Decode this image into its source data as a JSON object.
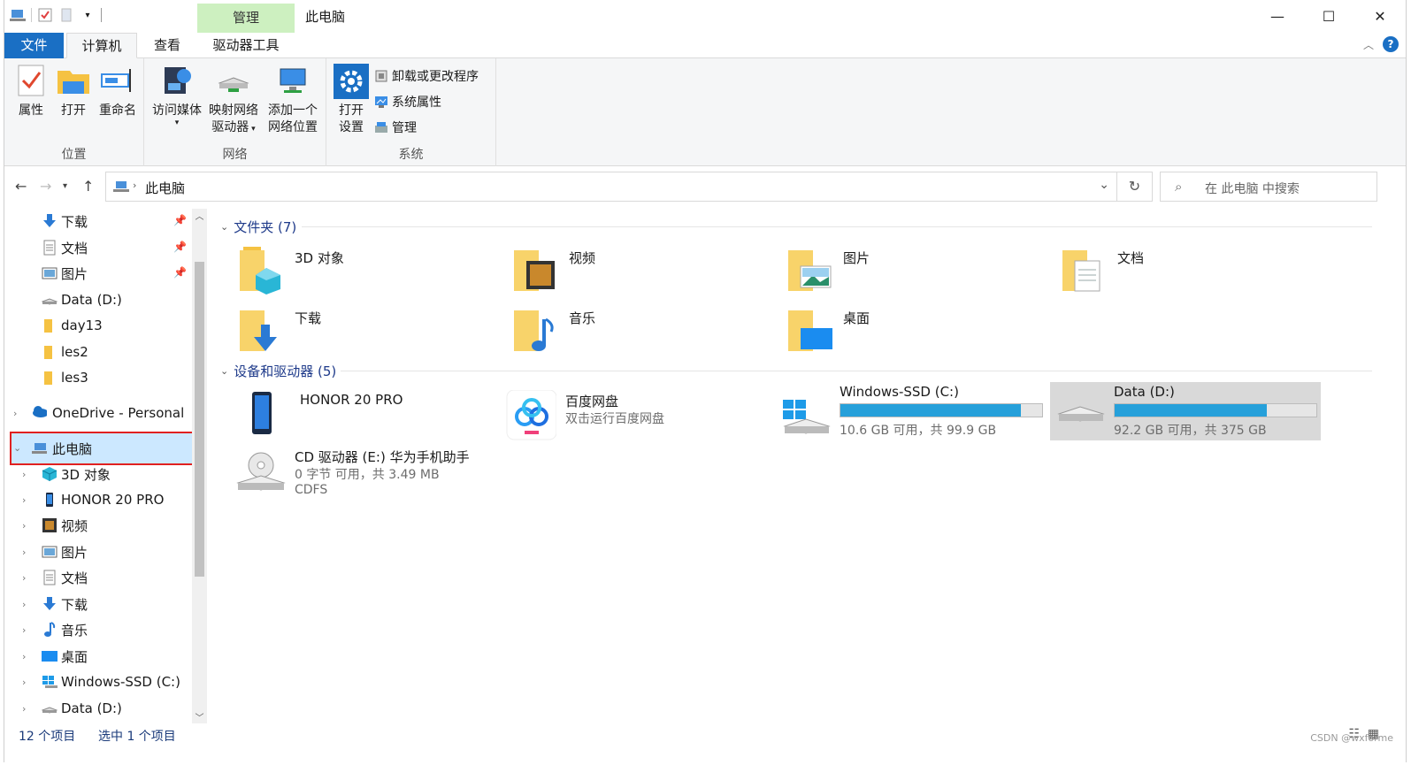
{
  "window": {
    "title": "此电脑",
    "context_tab": "管理",
    "controls": {
      "minimize": "—",
      "maximize": "☐",
      "close": "✕"
    }
  },
  "tabs": [
    {
      "label": "文件"
    },
    {
      "label": "计算机"
    },
    {
      "label": "查看"
    },
    {
      "label": "驱动器工具"
    }
  ],
  "ribbon": {
    "groups": [
      {
        "label": "位置",
        "buttons": [
          "属性",
          "打开",
          "重命名"
        ]
      },
      {
        "label": "网络",
        "buttons": [
          "访问媒体",
          "映射网络\n驱动器",
          "添加一个\n网络位置"
        ]
      },
      {
        "label": "系统",
        "big": "打开\n设置",
        "small": [
          "卸载或更改程序",
          "系统属性",
          "管理"
        ]
      }
    ],
    "btn_props": "属性",
    "btn_open": "打开",
    "btn_rename": "重命名",
    "btn_media": "访问媒体",
    "btn_map1": "映射网络",
    "btn_map2": "驱动器",
    "btn_add1": "添加一个",
    "btn_add2": "网络位置",
    "btn_settings1": "打开",
    "btn_settings2": "设置",
    "small_uninstall": "卸载或更改程序",
    "small_sysprops": "系统属性",
    "small_manage": "管理",
    "g_location": "位置",
    "g_network": "网络",
    "g_system": "系统"
  },
  "address": {
    "breadcrumb": "此电脑",
    "search_placeholder": "在 此电脑 中搜索"
  },
  "nav": {
    "quick": [
      {
        "label": "下载",
        "pinned": true
      },
      {
        "label": "文档",
        "pinned": true
      },
      {
        "label": "图片",
        "pinned": true
      },
      {
        "label": "Data (D:)"
      },
      {
        "label": "day13"
      },
      {
        "label": "les2"
      },
      {
        "label": "les3"
      }
    ],
    "onedrive": "OneDrive - Personal",
    "this_pc": "此电脑",
    "pc_children": [
      {
        "label": "3D 对象"
      },
      {
        "label": "HONOR 20 PRO"
      },
      {
        "label": "视频"
      },
      {
        "label": "图片"
      },
      {
        "label": "文档"
      },
      {
        "label": "下载"
      },
      {
        "label": "音乐"
      },
      {
        "label": "桌面"
      },
      {
        "label": "Windows-SSD (C:)"
      },
      {
        "label": "Data (D:)"
      }
    ]
  },
  "content": {
    "folders_header": "文件夹 (7)",
    "folders": [
      {
        "label": "3D 对象"
      },
      {
        "label": "视频"
      },
      {
        "label": "图片"
      },
      {
        "label": "文档"
      },
      {
        "label": "下载"
      },
      {
        "label": "音乐"
      },
      {
        "label": "桌面"
      }
    ],
    "devices_header": "设备和驱动器 (5)",
    "devices": [
      {
        "label": "HONOR 20 PRO"
      },
      {
        "label": "百度网盘",
        "sub": "双击运行百度网盘"
      },
      {
        "label": "Windows-SSD (C:)",
        "free": "10.6 GB 可用，共 99.9 GB",
        "used_fraction": 0.894
      },
      {
        "label": "Data (D:)",
        "free": "92.2 GB 可用，共 375 GB",
        "used_fraction": 0.754
      },
      {
        "label": "CD 驱动器 (E:) 华为手机助手",
        "free": "0 字节 可用，共 3.49 MB",
        "fs": "CDFS"
      }
    ]
  },
  "status": {
    "count": "12 个项目",
    "selected": "选中 1 个项目"
  },
  "watermark": "CSDN @wxforme",
  "colors": {
    "accent": "#1a6fc4",
    "context_tab": "#cdf0c0",
    "selection": "#cce8ff",
    "highlight_border": "#e02020",
    "drive_bar": "#26a0da",
    "folder_yellow": "#f5c242"
  }
}
